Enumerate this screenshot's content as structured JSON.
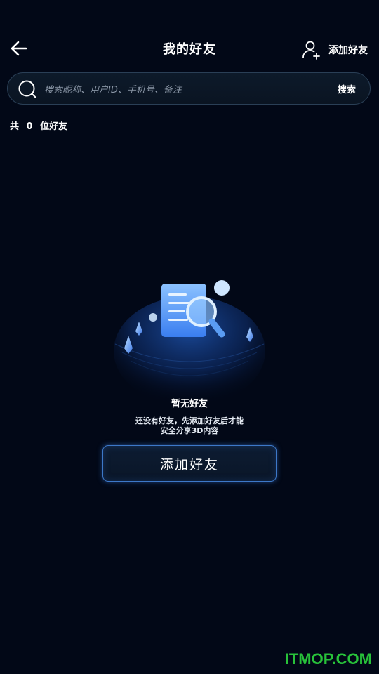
{
  "header": {
    "title": "我的好友",
    "add_friend_label": "添加好友"
  },
  "search": {
    "placeholder": "搜索昵称、用户ID、手机号、备注",
    "value": "",
    "button_label": "搜索"
  },
  "friend_count": {
    "prefix": "共",
    "count": "0",
    "suffix": "位好友"
  },
  "empty_state": {
    "title": "暂无好友",
    "desc_line1": "还没有好友，先添加好友后才能",
    "desc_line2": "安全分享3D内容",
    "button_label": "添加好友"
  },
  "watermark": "ITMOP.COM",
  "colors": {
    "background": "#020817",
    "accent_blue": "#3d78c8",
    "watermark_green": "#28c23a"
  }
}
